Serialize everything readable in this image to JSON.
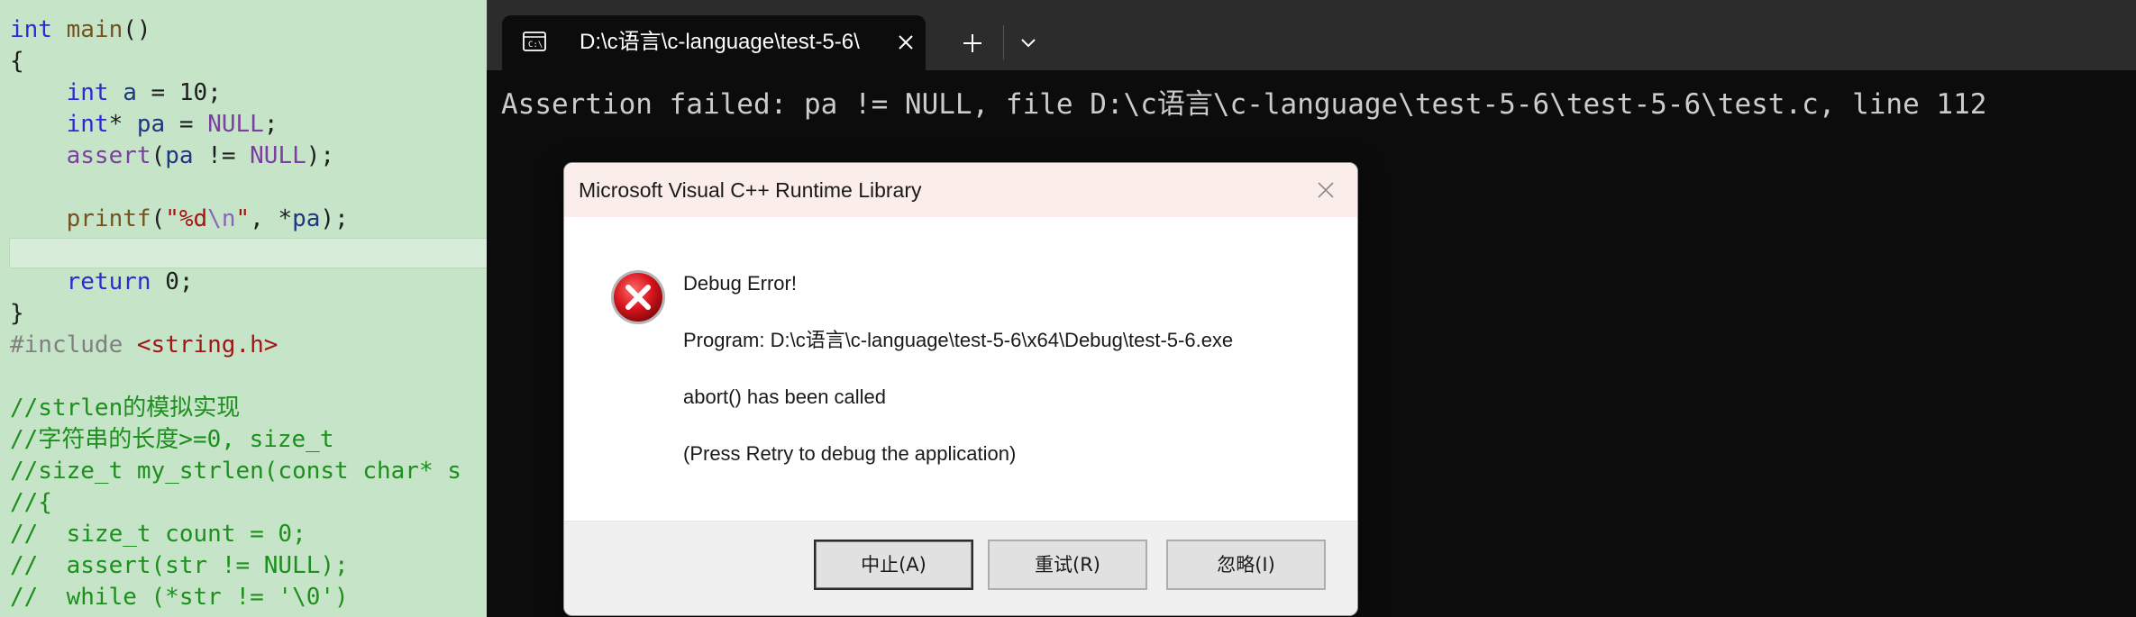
{
  "editor": {
    "lines": [
      [
        {
          "t": "int",
          "c": "kw"
        },
        {
          "t": " "
        },
        {
          "t": "main",
          "c": "fn"
        },
        {
          "t": "()"
        }
      ],
      [
        {
          "t": "{"
        }
      ],
      [
        {
          "t": "    "
        },
        {
          "t": "int",
          "c": "kw"
        },
        {
          "t": " "
        },
        {
          "t": "a",
          "c": "var"
        },
        {
          "t": " = 10;"
        }
      ],
      [
        {
          "t": "    "
        },
        {
          "t": "int",
          "c": "kw"
        },
        {
          "t": "* "
        },
        {
          "t": "pa",
          "c": "var"
        },
        {
          "t": " = "
        },
        {
          "t": "NULL",
          "c": "mac"
        },
        {
          "t": ";"
        }
      ],
      [
        {
          "t": "    "
        },
        {
          "t": "assert",
          "c": "mac"
        },
        {
          "t": "("
        },
        {
          "t": "pa",
          "c": "var"
        },
        {
          "t": " != "
        },
        {
          "t": "NULL",
          "c": "mac"
        },
        {
          "t": ");"
        }
      ],
      [
        {
          "t": ""
        }
      ],
      [
        {
          "t": "    "
        },
        {
          "t": "printf",
          "c": "fn"
        },
        {
          "t": "("
        },
        {
          "t": "\"%d",
          "c": "str"
        },
        {
          "t": "\\n",
          "c": "esc"
        },
        {
          "t": "\"",
          "c": "str"
        },
        {
          "t": ", *"
        },
        {
          "t": "pa",
          "c": "var"
        },
        {
          "t": ");"
        }
      ],
      [
        {
          "t": ""
        }
      ],
      [
        {
          "t": "    "
        },
        {
          "t": "return",
          "c": "kw"
        },
        {
          "t": " 0;"
        }
      ],
      [
        {
          "t": "}"
        }
      ],
      [
        {
          "t": "#include",
          "c": "pp"
        },
        {
          "t": " "
        },
        {
          "t": "<string.h>",
          "c": "inc"
        }
      ],
      [
        {
          "t": ""
        }
      ],
      [
        {
          "t": "//strlen的模拟实现",
          "c": "cmt"
        }
      ],
      [
        {
          "t": "//字符串的长度>=0, size_t",
          "c": "cmt"
        }
      ],
      [
        {
          "t": "//size_t my_strlen(const char* s",
          "c": "cmt"
        }
      ],
      [
        {
          "t": "//{",
          "c": "cmt"
        }
      ],
      [
        {
          "t": "//  size_t count = 0;",
          "c": "cmt"
        }
      ],
      [
        {
          "t": "//  assert(str != NULL);",
          "c": "cmt"
        }
      ],
      [
        {
          "t": "//  while (*str != '\\0')",
          "c": "cmt"
        }
      ]
    ]
  },
  "terminal": {
    "tab_title": "D:\\c语言\\c-language\\test-5-6\\",
    "new_tab_icon": "plus-icon",
    "dropdown_icon": "chevron-down-icon",
    "output": "Assertion failed: pa != NULL, file D:\\c语言\\c-language\\test-5-6\\test-5-6\\test.c, line 112"
  },
  "dialog": {
    "title": "Microsoft Visual C++ Runtime Library",
    "icon": "error-icon",
    "heading": "Debug Error!",
    "program": "Program: D:\\c语言\\c-language\\test-5-6\\x64\\Debug\\test-5-6.exe",
    "message": "abort() has been called",
    "hint": "(Press Retry to debug the application)",
    "buttons": {
      "abort": "中止(A)",
      "retry": "重试(R)",
      "ignore": "忽略(I)"
    }
  },
  "colors": {
    "editor_bg": "#c6e4c8",
    "terminal_bg": "#0c0c0c",
    "titlebar_bg": "#2c2c2c",
    "error_red": "#c0141c"
  }
}
